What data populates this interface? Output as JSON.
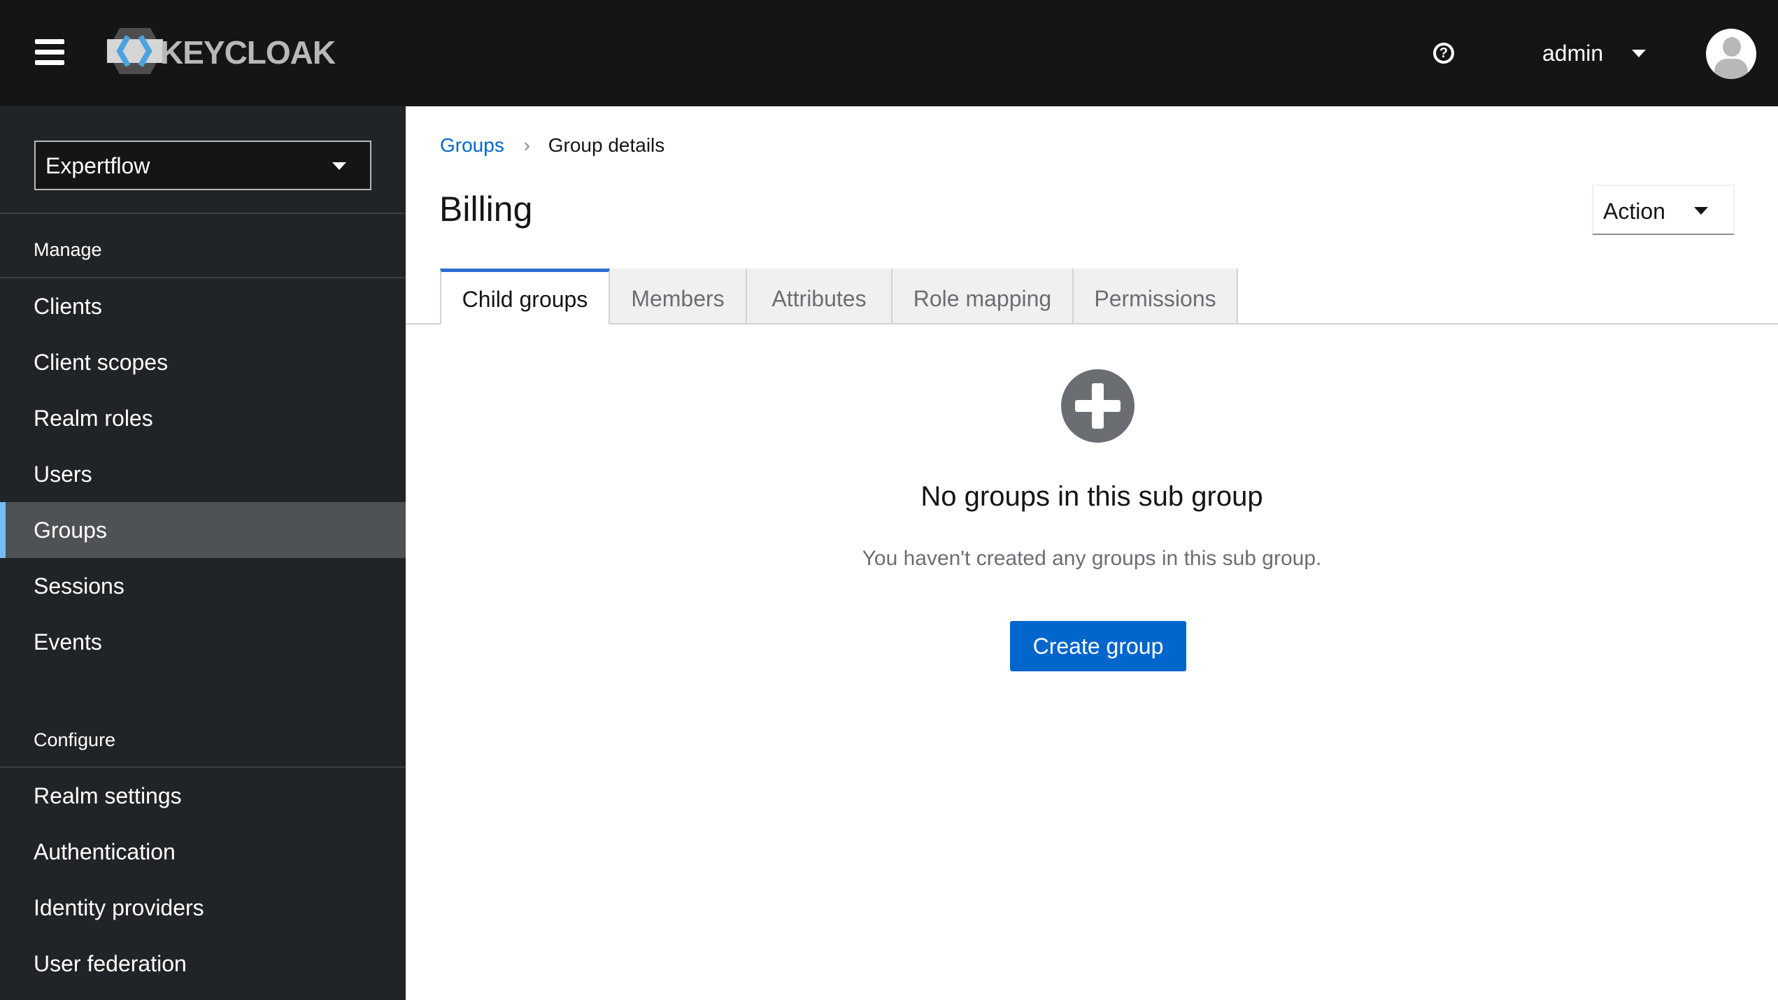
{
  "header": {
    "brand": "KEYCLOAK",
    "username": "admin",
    "icons": [
      "hamburger-icon",
      "help-icon",
      "caret-down-icon",
      "avatar"
    ]
  },
  "sidebar": {
    "realm": "Expertflow",
    "manage_label": "Manage",
    "manage_items": [
      {
        "label": "Clients"
      },
      {
        "label": "Client scopes"
      },
      {
        "label": "Realm roles"
      },
      {
        "label": "Users"
      },
      {
        "label": "Groups",
        "active": true
      },
      {
        "label": "Sessions"
      },
      {
        "label": "Events"
      }
    ],
    "configure_label": "Configure",
    "configure_items": [
      {
        "label": "Realm settings"
      },
      {
        "label": "Authentication"
      },
      {
        "label": "Identity providers"
      },
      {
        "label": "User federation"
      }
    ]
  },
  "main": {
    "breadcrumb": {
      "parent": "Groups",
      "current": "Group details"
    },
    "title": "Billing",
    "action_label": "Action",
    "tabs": [
      {
        "label": "Child groups",
        "active": true
      },
      {
        "label": "Members"
      },
      {
        "label": "Attributes"
      },
      {
        "label": "Role mapping"
      },
      {
        "label": "Permissions"
      }
    ],
    "empty": {
      "title": "No groups in this sub group",
      "body": "You haven't created any groups in this sub group.",
      "button": "Create group"
    }
  },
  "colors": {
    "accent": "#0066cc",
    "header_bg": "#151515",
    "sidebar_bg": "#212427",
    "active_marker": "#73bcf7"
  }
}
